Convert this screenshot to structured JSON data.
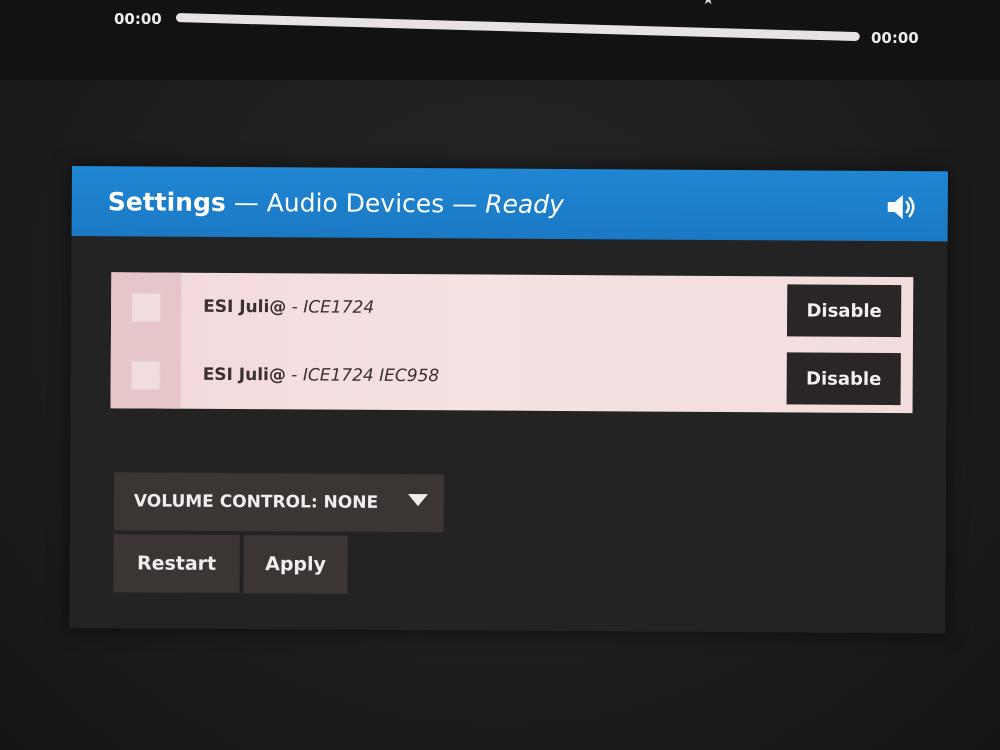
{
  "player": {
    "time_elapsed": "00:00",
    "time_total": "00:00",
    "progress": 0
  },
  "header": {
    "title": "Settings",
    "separator_1": " — ",
    "section": "Audio Devices",
    "separator_2": " — ",
    "status": "Ready",
    "icon": "speaker-icon"
  },
  "devices": [
    {
      "label": "ESI Juli@",
      "separator": " - ",
      "model": "ICE1724",
      "checked": false,
      "button_label": "Disable"
    },
    {
      "label": "ESI Juli@",
      "separator": " - ",
      "model": "ICE1724 IEC958",
      "checked": false,
      "button_label": "Disable"
    }
  ],
  "volume_control": {
    "label": "VOLUME CONTROL: NONE",
    "icon": "chevron-down-icon"
  },
  "actions": {
    "restart_label": "Restart",
    "apply_label": "Apply"
  },
  "colors": {
    "header_blue": "#1f86d3",
    "device_list_bg": "#f4dfe0",
    "button_dark": "#2a2625",
    "control_bg": "#3b3534"
  }
}
